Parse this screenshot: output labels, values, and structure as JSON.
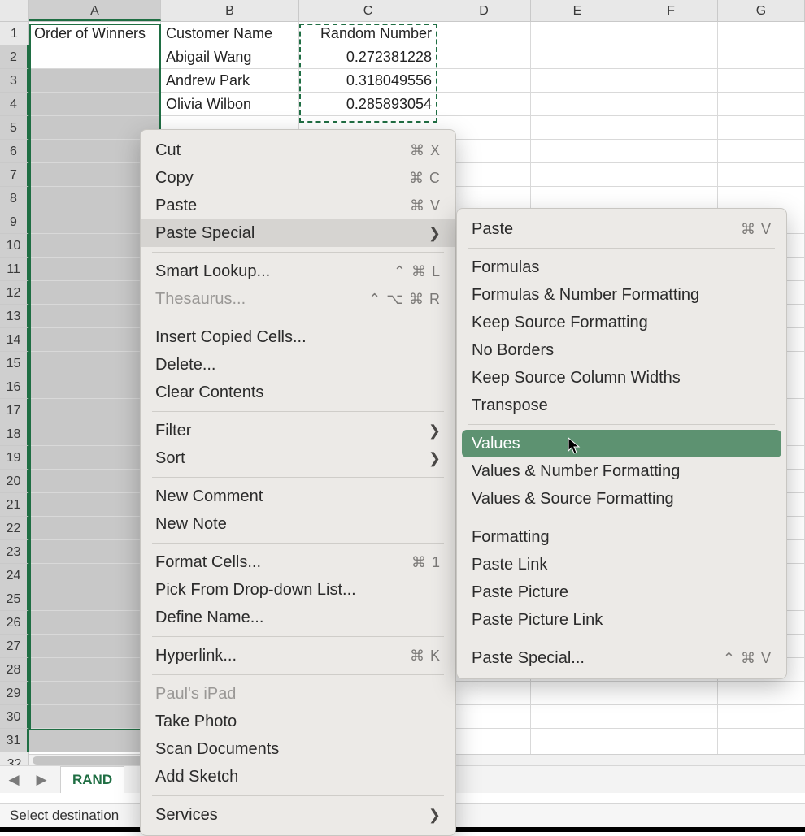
{
  "columns": [
    "A",
    "B",
    "C",
    "D",
    "E",
    "F",
    "G"
  ],
  "col_widths": {
    "A": 162,
    "B": 170,
    "C": 170,
    "D": 115,
    "E": 115,
    "F": 115,
    "G": 107
  },
  "row_count": 32,
  "headers": {
    "A": "Order of Winners",
    "B": "Customer Name",
    "C": "Random Number"
  },
  "data_rows": [
    {
      "B": "Abigail Wang",
      "C": "0.272381228"
    },
    {
      "B": "Andrew Park",
      "C": "0.318049556"
    },
    {
      "B": "Olivia Wilbon",
      "C": "0.285893054"
    }
  ],
  "selected_column": "A",
  "selected_rows": [
    2,
    31
  ],
  "active_cell_row": 2,
  "sheet_tab": "RAND",
  "status_text": "Select destination",
  "context_menu": {
    "groups": [
      [
        {
          "label": "Cut",
          "shortcut": "⌘ X"
        },
        {
          "label": "Copy",
          "shortcut": "⌘ C"
        },
        {
          "label": "Paste",
          "shortcut": "⌘ V"
        },
        {
          "label": "Paste Special",
          "submenu": true,
          "hover": true
        }
      ],
      [
        {
          "label": "Smart Lookup...",
          "shortcut": "⌃ ⌘ L"
        },
        {
          "label": "Thesaurus...",
          "shortcut": "⌃ ⌥ ⌘ R",
          "disabled": true
        }
      ],
      [
        {
          "label": "Insert Copied Cells..."
        },
        {
          "label": "Delete..."
        },
        {
          "label": "Clear Contents"
        }
      ],
      [
        {
          "label": "Filter",
          "submenu": true
        },
        {
          "label": "Sort",
          "submenu": true
        }
      ],
      [
        {
          "label": "New Comment"
        },
        {
          "label": "New Note"
        }
      ],
      [
        {
          "label": "Format Cells...",
          "shortcut": "⌘ 1"
        },
        {
          "label": "Pick From Drop-down List..."
        },
        {
          "label": "Define Name..."
        }
      ],
      [
        {
          "label": "Hyperlink...",
          "shortcut": "⌘ K"
        }
      ],
      [
        {
          "label": "Paul's iPad",
          "disabled": true
        },
        {
          "label": "Take Photo"
        },
        {
          "label": "Scan Documents"
        },
        {
          "label": "Add Sketch"
        }
      ],
      [
        {
          "label": "Services",
          "submenu": true
        }
      ]
    ]
  },
  "submenu": {
    "groups": [
      [
        {
          "label": "Paste",
          "shortcut": "⌘ V"
        }
      ],
      [
        {
          "label": "Formulas"
        },
        {
          "label": "Formulas & Number Formatting"
        },
        {
          "label": "Keep Source Formatting"
        },
        {
          "label": "No Borders"
        },
        {
          "label": "Keep Source Column Widths"
        },
        {
          "label": "Transpose"
        }
      ],
      [
        {
          "label": "Values",
          "selected": true
        },
        {
          "label": "Values & Number Formatting"
        },
        {
          "label": "Values & Source Formatting"
        }
      ],
      [
        {
          "label": "Formatting"
        },
        {
          "label": "Paste Link"
        },
        {
          "label": "Paste Picture"
        },
        {
          "label": "Paste Picture Link"
        }
      ],
      [
        {
          "label": "Paste Special...",
          "shortcut": "⌃ ⌘ V"
        }
      ]
    ]
  }
}
